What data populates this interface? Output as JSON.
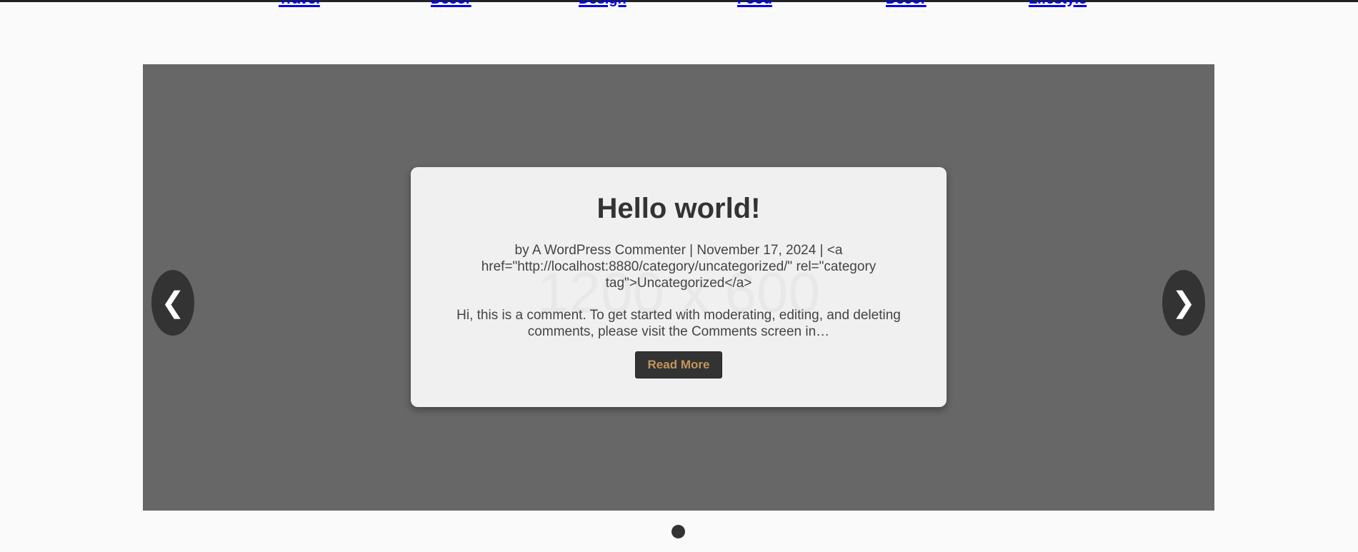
{
  "nav": {
    "items": [
      {
        "label": "Travel"
      },
      {
        "label": "Decor"
      },
      {
        "label": "Design"
      },
      {
        "label": "Food"
      },
      {
        "label": "Decor"
      },
      {
        "label": "Lifestyle"
      }
    ]
  },
  "slider": {
    "placeholder": "1200 x 600",
    "slide": {
      "title": "Hello world!",
      "meta": "by A WordPress Commenter | November 17, 2024 | <a href=\"http://localhost:8880/category/uncategorized/\" rel=\"category tag\">Uncategorized</a>",
      "excerpt": "Hi, this is a comment. To get started with moderating, editing, and deleting comments, please visit the Comments screen in…",
      "button": "Read More"
    },
    "prev": "❮",
    "next": "❯",
    "current_slide": 1,
    "total_slides": 1
  }
}
